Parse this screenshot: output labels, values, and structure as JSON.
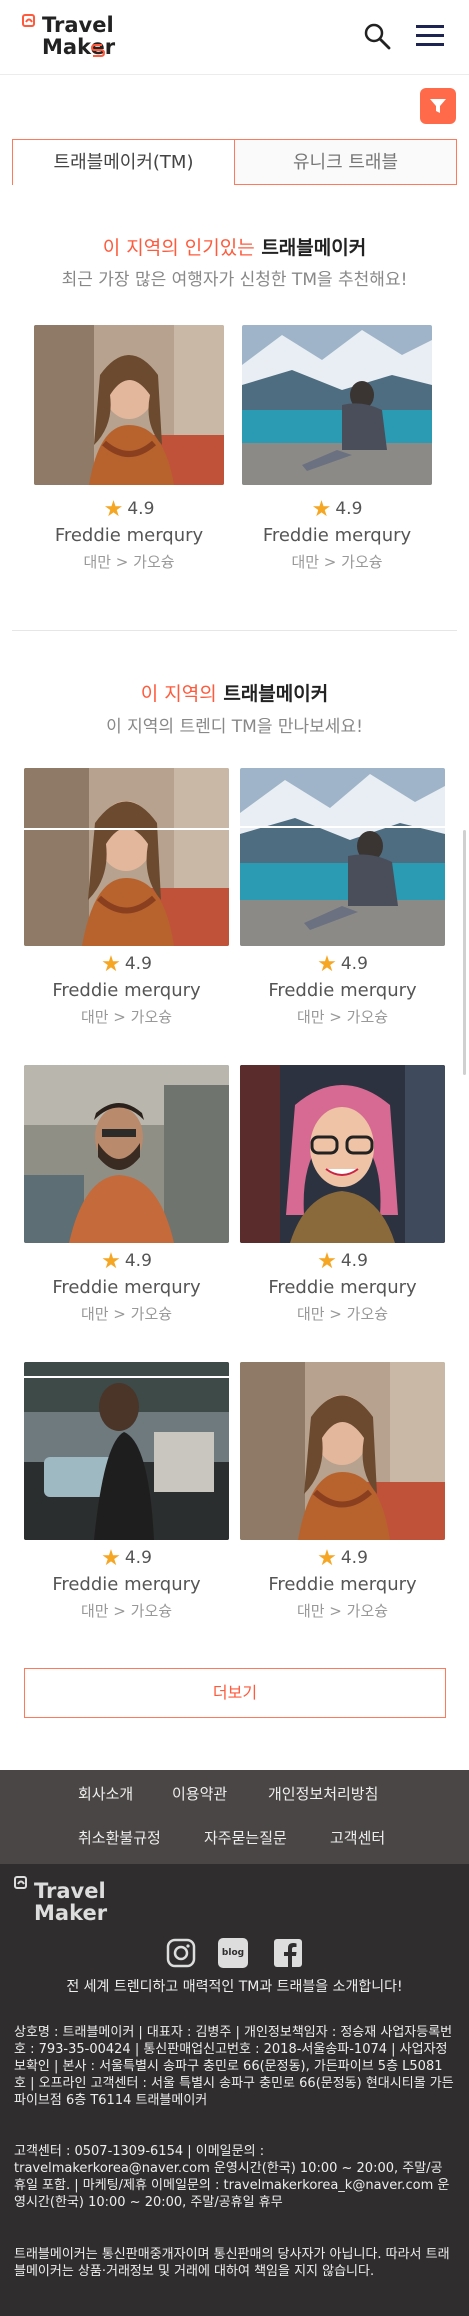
{
  "header": {
    "logo_text_line1": "Travel",
    "logo_text_line2": "Maker",
    "search_icon": "search-icon",
    "menu_icon": "hamburger-menu-icon"
  },
  "filter": {
    "icon": "filter-icon"
  },
  "tabs": [
    {
      "label": "트래블메이커(TM)",
      "active": true
    },
    {
      "label": "유니크 트래블",
      "active": false
    }
  ],
  "popular": {
    "title_accent": "이 지역의 인기있는",
    "title_rest": " 트래블메이커",
    "subtitle": "최근 가장 많은 여행자가 신청한 TM을 추천해요!",
    "cards": [
      {
        "rating": "4.9",
        "name": "Freddie merqury",
        "location": "대만 > 가오슝"
      },
      {
        "rating": "4.9",
        "name": "Freddie merqury",
        "location": "대만 > 가오슝"
      }
    ]
  },
  "regional": {
    "title_accent": "이 지역의",
    "title_rest": " 트래블메이커",
    "subtitle": "이 지역의 트렌디 TM을 만나보세요!",
    "cards": [
      {
        "rating": "4.9",
        "name": "Freddie merqury",
        "location": "대만 > 가오슝"
      },
      {
        "rating": "4.9",
        "name": "Freddie merqury",
        "location": "대만 > 가오슝"
      },
      {
        "rating": "4.9",
        "name": "Freddie merqury",
        "location": "대만 > 가오슝"
      },
      {
        "rating": "4.9",
        "name": "Freddie merqury",
        "location": "대만 > 가오슝"
      },
      {
        "rating": "4.9",
        "name": "Freddie merqury",
        "location": "대만 > 가오슝"
      },
      {
        "rating": "4.9",
        "name": "Freddie merqury",
        "location": "대만 > 가오슝"
      }
    ],
    "more_label": "더보기"
  },
  "footer_nav": {
    "row1": [
      "회사소개",
      "이용약관",
      "개인정보처리방침"
    ],
    "row2": [
      "취소환불규정",
      "자주묻는질문",
      "고객센터"
    ]
  },
  "footer": {
    "logo_text_line1": "Travel",
    "logo_text_line2": "Maker",
    "social_icons": [
      "instagram-icon",
      "blog-icon",
      "facebook-icon"
    ],
    "blog_label": "blog",
    "tagline": "전 세계 트렌디하고 매력적인 TM과 트래블을 소개합니다!",
    "company_info": "상호명 : 트래블메이커 | 대표자 : 김병주 | 개인정보책임자 : 정승재 사업자등록번호 : 793-35-00424 | 통신판매업신고번호 : 2018-서울송파-1074 | 사업자정보확인 | 본사 : 서울특별시 송파구 충민로 66(문정동), 가든파이브 5층 L5081호 | 오프라인 고객센터 : 서울 특별시 송파구 충민로 66(문정동) 현대시티몰 가든파이브점 6층 T6114 트래블메이커",
    "contact_info": "고객센터 : 0507-1309-6154 | 이메일문의 : travelmakerkorea@naver.com 운영시간(한국) 10:00 ~ 20:00, 주말/공휴일 포함. | 마케팅/제휴 이메일문의 : travelmakerkorea_k@naver.com 운영시간(한국) 10:00 ~ 20:00, 주말/공휴일 휴무",
    "disclaimer": "트래블메이커는 통신판매중개자이며 통신판매의 당사자가 아닙니다. 따라서 트래블메이커는 상품·거래정보 및 거래에 대하여 책임을 지지 않습니다."
  },
  "colors": {
    "accent": "#ff5a3c",
    "star": "#f5a623",
    "footer_nav_bg": "#4a4645",
    "footer_bg": "#2f2d2d"
  }
}
